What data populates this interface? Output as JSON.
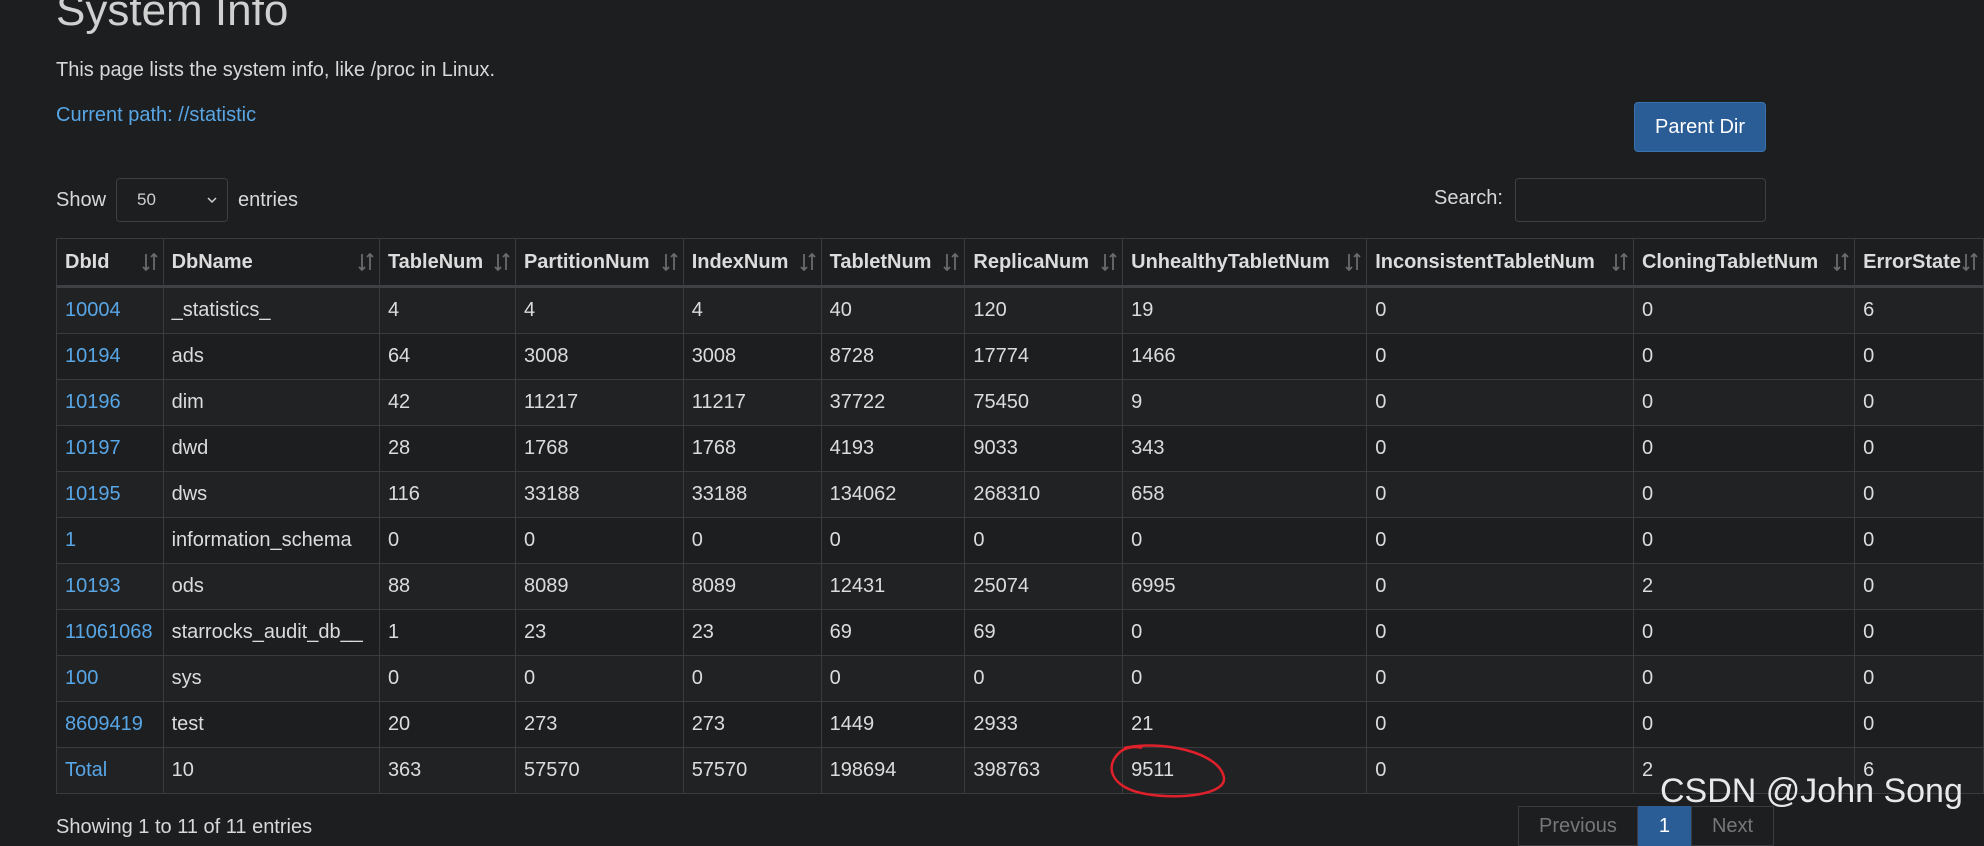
{
  "page": {
    "title": "System Info",
    "description": "This page lists the system info, like /proc in Linux.",
    "current_path": "Current path: //statistic",
    "parent_button": "Parent Dir"
  },
  "controls": {
    "show_label": "Show",
    "entries_value": "50",
    "entries_label": "entries",
    "search_label": "Search:",
    "search_value": ""
  },
  "table": {
    "columns": [
      "DbId",
      "DbName",
      "TableNum",
      "PartitionNum",
      "IndexNum",
      "TabletNum",
      "ReplicaNum",
      "UnhealthyTabletNum",
      "InconsistentTabletNum",
      "CloningTabletNum",
      "ErrorState"
    ],
    "rows": [
      [
        "10004",
        "_statistics_",
        "4",
        "4",
        "4",
        "40",
        "120",
        "19",
        "0",
        "0",
        "6"
      ],
      [
        "10194",
        "ads",
        "64",
        "3008",
        "3008",
        "8728",
        "17774",
        "1466",
        "0",
        "0",
        "0"
      ],
      [
        "10196",
        "dim",
        "42",
        "11217",
        "11217",
        "37722",
        "75450",
        "9",
        "0",
        "0",
        "0"
      ],
      [
        "10197",
        "dwd",
        "28",
        "1768",
        "1768",
        "4193",
        "9033",
        "343",
        "0",
        "0",
        "0"
      ],
      [
        "10195",
        "dws",
        "116",
        "33188",
        "33188",
        "134062",
        "268310",
        "658",
        "0",
        "0",
        "0"
      ],
      [
        "1",
        "information_schema",
        "0",
        "0",
        "0",
        "0",
        "0",
        "0",
        "0",
        "0",
        "0"
      ],
      [
        "10193",
        "ods",
        "88",
        "8089",
        "8089",
        "12431",
        "25074",
        "6995",
        "0",
        "2",
        "0"
      ],
      [
        "11061068",
        "starrocks_audit_db__",
        "1",
        "23",
        "23",
        "69",
        "69",
        "0",
        "0",
        "0",
        "0"
      ],
      [
        "100",
        "sys",
        "0",
        "0",
        "0",
        "0",
        "0",
        "0",
        "0",
        "0",
        "0"
      ],
      [
        "8609419",
        "test",
        "20",
        "273",
        "273",
        "1449",
        "2933",
        "21",
        "0",
        "0",
        "0"
      ],
      [
        "Total",
        "10",
        "363",
        "57570",
        "57570",
        "198694",
        "398763",
        "9511",
        "0",
        "2",
        "6"
      ]
    ]
  },
  "footer": {
    "showing": "Showing 1 to 11 of 11 entries",
    "previous": "Previous",
    "page": "1",
    "next": "Next"
  },
  "watermark": "CSDN @John Song",
  "colors": {
    "accent": "#2a5d95",
    "link": "#58a6e6",
    "annotation": "#e0202a"
  }
}
